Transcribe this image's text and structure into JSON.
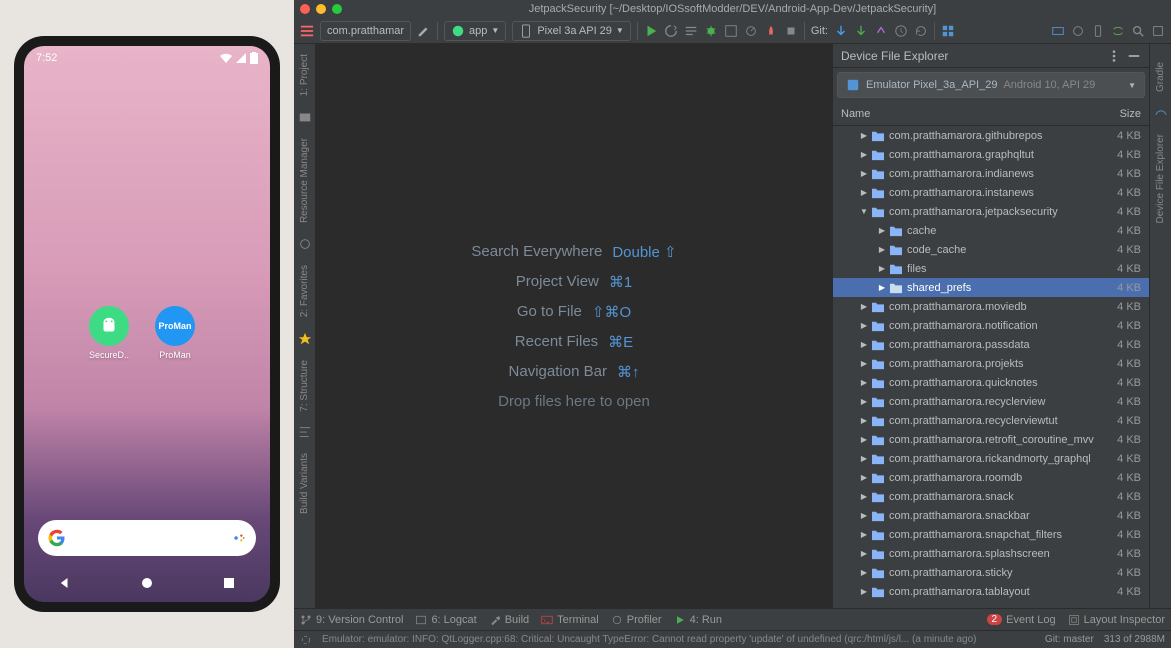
{
  "titlebar": {
    "title": "JetpackSecurity [~/Desktop/IOSsoftModder/DEV/Android-App-Dev/JetpackSecurity]"
  },
  "toolbar": {
    "project_dropdown": "com.pratthamar",
    "module_dropdown": "app",
    "device_dropdown": "Pixel 3a API 29",
    "git_label": "Git:"
  },
  "emulator": {
    "time": "7:52",
    "apps": [
      {
        "name": "SecureD..",
        "icon_style": "green"
      },
      {
        "name": "ProMan",
        "icon_style": "blue",
        "icon_text": "ProMan"
      }
    ]
  },
  "left_rail": [
    {
      "label": "1: Project"
    },
    {
      "label": "Resource Manager"
    },
    {
      "label": "2: Favorites"
    },
    {
      "label": "7: Structure"
    },
    {
      "label": "Build Variants"
    }
  ],
  "right_rail": [
    {
      "label": "Gradle"
    },
    {
      "label": "Device File Explorer"
    }
  ],
  "editor_hints": [
    {
      "label": "Search Everywhere",
      "key": "Double ⇧"
    },
    {
      "label": "Project View",
      "key": "⌘1"
    },
    {
      "label": "Go to File",
      "key": "⇧⌘O"
    },
    {
      "label": "Recent Files",
      "key": "⌘E"
    },
    {
      "label": "Navigation Bar",
      "key": "⌘↑"
    }
  ],
  "editor_drop_hint": "Drop files here to open",
  "device_explorer": {
    "title": "Device File Explorer",
    "device": "Emulator Pixel_3a_API_29",
    "api": "Android 10, API 29",
    "columns": {
      "name": "Name",
      "size": "Size"
    },
    "tree": [
      {
        "indent": 1,
        "expanded": false,
        "name": "com.pratthamarora.githubrepos",
        "size": "4 KB"
      },
      {
        "indent": 1,
        "expanded": false,
        "name": "com.pratthamarora.graphqltut",
        "size": "4 KB"
      },
      {
        "indent": 1,
        "expanded": false,
        "name": "com.pratthamarora.indianews",
        "size": "4 KB"
      },
      {
        "indent": 1,
        "expanded": false,
        "name": "com.pratthamarora.instanews",
        "size": "4 KB"
      },
      {
        "indent": 1,
        "expanded": true,
        "name": "com.pratthamarora.jetpacksecurity",
        "size": "4 KB"
      },
      {
        "indent": 2,
        "expanded": false,
        "name": "cache",
        "size": "4 KB"
      },
      {
        "indent": 2,
        "expanded": false,
        "name": "code_cache",
        "size": "4 KB"
      },
      {
        "indent": 2,
        "expanded": false,
        "name": "files",
        "size": "4 KB"
      },
      {
        "indent": 2,
        "expanded": false,
        "name": "shared_prefs",
        "size": "4 KB",
        "selected": true
      },
      {
        "indent": 1,
        "expanded": false,
        "name": "com.pratthamarora.moviedb",
        "size": "4 KB"
      },
      {
        "indent": 1,
        "expanded": false,
        "name": "com.pratthamarora.notification",
        "size": "4 KB"
      },
      {
        "indent": 1,
        "expanded": false,
        "name": "com.pratthamarora.passdata",
        "size": "4 KB"
      },
      {
        "indent": 1,
        "expanded": false,
        "name": "com.pratthamarora.projekts",
        "size": "4 KB"
      },
      {
        "indent": 1,
        "expanded": false,
        "name": "com.pratthamarora.quicknotes",
        "size": "4 KB"
      },
      {
        "indent": 1,
        "expanded": false,
        "name": "com.pratthamarora.recyclerview",
        "size": "4 KB"
      },
      {
        "indent": 1,
        "expanded": false,
        "name": "com.pratthamarora.recyclerviewtut",
        "size": "4 KB"
      },
      {
        "indent": 1,
        "expanded": false,
        "name": "com.pratthamarora.retrofit_coroutine_mvv",
        "size": "4 KB"
      },
      {
        "indent": 1,
        "expanded": false,
        "name": "com.pratthamarora.rickandmorty_graphql",
        "size": "4 KB"
      },
      {
        "indent": 1,
        "expanded": false,
        "name": "com.pratthamarora.roomdb",
        "size": "4 KB"
      },
      {
        "indent": 1,
        "expanded": false,
        "name": "com.pratthamarora.snack",
        "size": "4 KB"
      },
      {
        "indent": 1,
        "expanded": false,
        "name": "com.pratthamarora.snackbar",
        "size": "4 KB"
      },
      {
        "indent": 1,
        "expanded": false,
        "name": "com.pratthamarora.snapchat_filters",
        "size": "4 KB"
      },
      {
        "indent": 1,
        "expanded": false,
        "name": "com.pratthamarora.splashscreen",
        "size": "4 KB"
      },
      {
        "indent": 1,
        "expanded": false,
        "name": "com.pratthamarora.sticky",
        "size": "4 KB"
      },
      {
        "indent": 1,
        "expanded": false,
        "name": "com.pratthamarora.tablayout",
        "size": "4 KB"
      }
    ]
  },
  "bottom_bar": {
    "items": [
      {
        "icon": "branch",
        "label": "9: Version Control"
      },
      {
        "icon": "logcat",
        "label": "6: Logcat"
      },
      {
        "icon": "hammer",
        "label": "Build"
      },
      {
        "icon": "terminal",
        "label": "Terminal"
      },
      {
        "icon": "profiler",
        "label": "Profiler"
      },
      {
        "icon": "run",
        "label": "4: Run"
      }
    ],
    "right": [
      {
        "icon": "event",
        "label": "Event Log",
        "badge": "2"
      },
      {
        "icon": "layout",
        "label": "Layout Inspector"
      }
    ]
  },
  "statusbar": {
    "loading_icon": true,
    "message": "Emulator: emulator: INFO: QtLogger.cpp:68: Critical: Uncaught TypeError: Cannot read property 'update' of undefined (qrc:/html/js/l... (a minute ago)",
    "git": "Git: master",
    "mem": "313 of 2988M"
  }
}
